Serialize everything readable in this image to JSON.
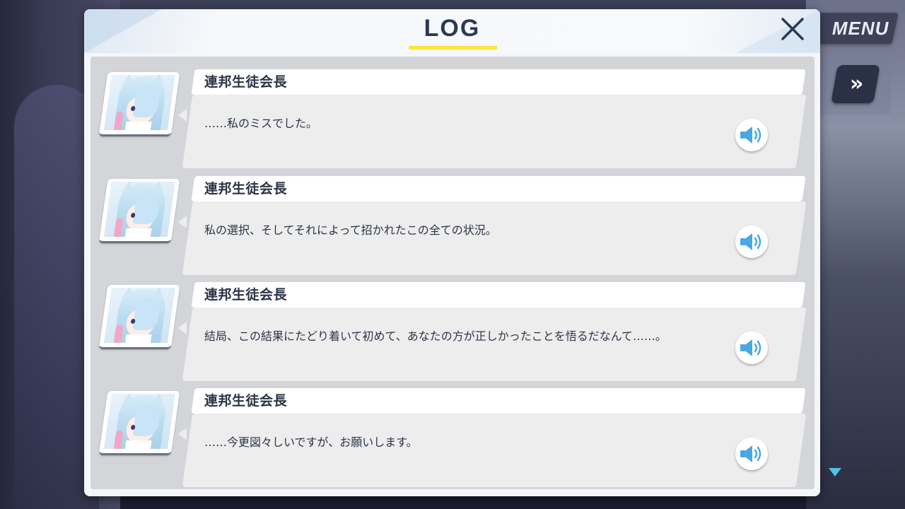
{
  "hud": {
    "menu_label": "MENU",
    "fast_forward_label": "»"
  },
  "log": {
    "title": "LOG",
    "accent_color": "#ffe33a",
    "title_color": "#2a3a55",
    "voice_icon_color": "#4aa8e0",
    "entries": [
      {
        "speaker": "連邦生徒会長",
        "text": "……私のミスでした。",
        "icon": "speaker-icon"
      },
      {
        "speaker": "連邦生徒会長",
        "text": "私の選択、そしてそれによって招かれたこの全ての状況。",
        "icon": "speaker-icon"
      },
      {
        "speaker": "連邦生徒会長",
        "text": "結局、この結果にたどり着いて初めて、あなたの方が正しかったことを悟るだなんて……。",
        "icon": "speaker-icon"
      },
      {
        "speaker": "連邦生徒会長",
        "text": "……今更図々しいですが、お願いします。",
        "icon": "speaker-icon"
      }
    ]
  }
}
